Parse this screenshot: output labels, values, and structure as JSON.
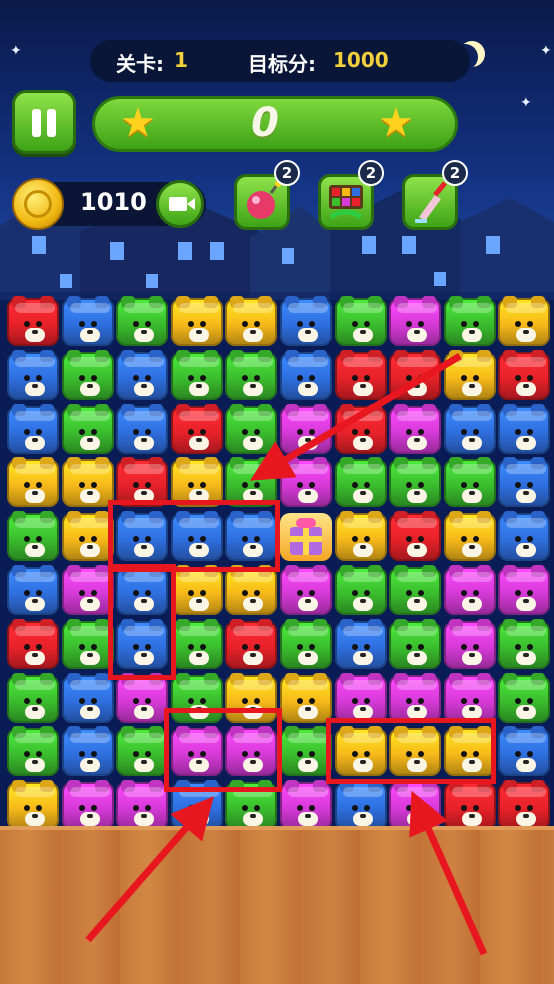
{
  "header": {
    "level_label": "关卡:",
    "level_value": "1",
    "target_label": "目标分:",
    "target_value": "1000"
  },
  "score": {
    "value": "0"
  },
  "coins": {
    "value": "1010"
  },
  "powerups": [
    {
      "name": "candy-bomb",
      "count": "2",
      "icon": "candy-bomb-icon"
    },
    {
      "name": "shuffle",
      "count": "2",
      "icon": "shuffle-icon"
    },
    {
      "name": "brush",
      "count": "2",
      "icon": "brush-icon"
    }
  ],
  "colors": {
    "R": "#e8222a",
    "B": "#2f6fe0",
    "G": "#3bbd2e",
    "Y": "#f7b91a",
    "P": "#d63ad8",
    "highlight": "#e8161e",
    "accent_green": "#4cb51c"
  },
  "board": {
    "rows": [
      "RBGYYBGPGY",
      "BGBGGBRRYR",
      "BGBRGPRPBB",
      "YYRYGPGGGB",
      "GYBBBXYRYB",
      "BPBYYPGGPP",
      "RGBGRGBGPG",
      "GBPGYYPPPG",
      "GBGPPGYYYB",
      "YPPBGPBPRR"
    ],
    "gift_icon": "gift-box-icon"
  }
}
